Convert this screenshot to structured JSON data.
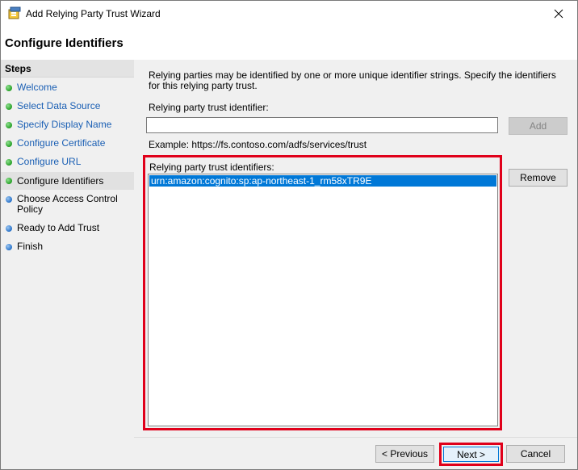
{
  "window": {
    "title": "Add Relying Party Trust Wizard",
    "close_icon": "close-icon"
  },
  "header": {
    "page_title": "Configure Identifiers"
  },
  "sidebar": {
    "heading": "Steps",
    "items": [
      {
        "label": "Welcome",
        "status": "done"
      },
      {
        "label": "Select Data Source",
        "status": "done"
      },
      {
        "label": "Specify Display Name",
        "status": "done"
      },
      {
        "label": "Configure Certificate",
        "status": "done"
      },
      {
        "label": "Configure URL",
        "status": "done"
      },
      {
        "label": "Configure Identifiers",
        "status": "current"
      },
      {
        "label": "Choose Access Control Policy",
        "status": "pending"
      },
      {
        "label": "Ready to Add Trust",
        "status": "pending"
      },
      {
        "label": "Finish",
        "status": "pending"
      }
    ]
  },
  "main": {
    "description": "Relying parties may be identified by one or more unique identifier strings. Specify the identifiers for this relying party trust.",
    "identifier_label": "Relying party trust identifier:",
    "identifier_value": "",
    "add_label": "Add",
    "example": "Example: https://fs.contoso.com/adfs/services/trust",
    "list_label": "Relying party trust identifiers:",
    "identifiers": [
      "urn:amazon:cognito:sp:ap-northeast-1_rm58xTR9E"
    ],
    "remove_label": "Remove"
  },
  "footer": {
    "previous_label": "< Previous",
    "next_label": "Next >",
    "cancel_label": "Cancel"
  },
  "colors": {
    "highlight_outline": "#e0001a",
    "selection": "#0078d7",
    "link": "#1a5fb4"
  }
}
